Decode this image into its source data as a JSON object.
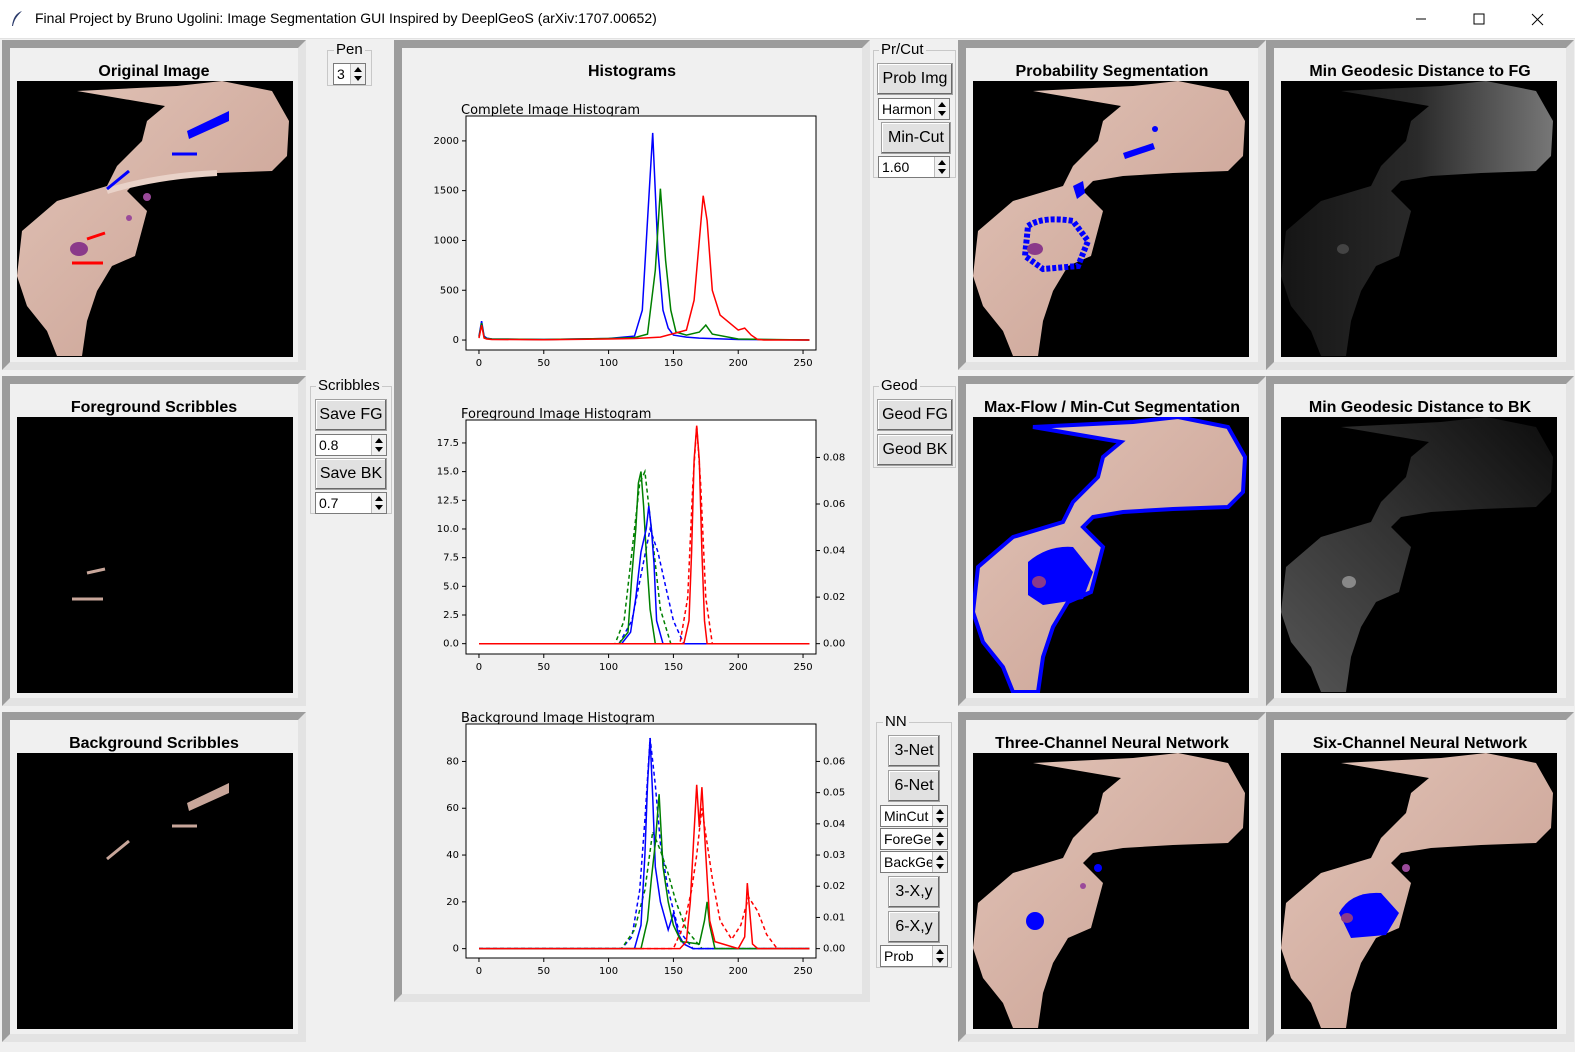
{
  "window": {
    "title": "Final Project by Bruno Ugolini: Image Segmentation GUI Inspired by DeeplGeoS (arXiv:1707.00652)"
  },
  "panels": {
    "original": "Original Image",
    "fg_scribbles": "Foreground Scribbles",
    "bk_scribbles": "Background Scribbles",
    "histograms": "Histograms",
    "prob_seg": "Probability Segmentation",
    "geo_fg": "Min Geodesic Distance to FG",
    "maxflow": "Max-Flow / Min-Cut Segmentation",
    "geo_bk": "Min Geodesic Distance to BK",
    "three_net": "Three-Channel Neural Network",
    "six_net": "Six-Channel Neural Network"
  },
  "controls": {
    "pen": {
      "label": "Pen",
      "value": "3"
    },
    "scribbles": {
      "label": "Scribbles",
      "save_fg": "Save FG",
      "fg_value": "0.8",
      "save_bk": "Save BK",
      "bk_value": "0.7"
    },
    "prcut": {
      "label": "Pr/Cut",
      "prob_img": "Prob Img",
      "method": "Harmon",
      "min_cut": "Min-Cut",
      "value": "1.60"
    },
    "geod": {
      "label": "Geod",
      "geod_fg": "Geod FG",
      "geod_bk": "Geod BK"
    },
    "nn": {
      "label": "NN",
      "net3": "3-Net",
      "net6": "6-Net",
      "opt1": "MinCut",
      "opt2": "ForeGeo",
      "opt3": "BackGeo",
      "xy3": "3-X,y",
      "xy6": "6-X,y",
      "mode": "Prob"
    }
  },
  "colors": {
    "red": "#ff0000",
    "green": "#008000",
    "blue": "#0000ff",
    "tissue": "#d6b5a8",
    "overlay": "#0000ff"
  },
  "chart_data": [
    {
      "type": "line",
      "title": "Complete Image Histogram",
      "xlim": [
        -10,
        260
      ],
      "ylim": [
        -100,
        2250
      ],
      "xticks": [
        "0",
        "50",
        "100",
        "150",
        "200",
        "250"
      ],
      "yticks": [
        "0",
        "500",
        "1000",
        "1500",
        "2000"
      ],
      "series": [
        {
          "color": "blue",
          "x": [
            0,
            2,
            4,
            6,
            10,
            50,
            100,
            120,
            126,
            130,
            134,
            138,
            142,
            146,
            150,
            160,
            170,
            200,
            255
          ],
          "values": [
            40,
            190,
            40,
            20,
            10,
            5,
            15,
            40,
            300,
            1200,
            2080,
            900,
            300,
            120,
            50,
            30,
            20,
            5,
            0
          ]
        },
        {
          "color": "green",
          "x": [
            0,
            2,
            4,
            6,
            10,
            50,
            100,
            120,
            130,
            136,
            140,
            144,
            148,
            152,
            160,
            170,
            175,
            180,
            200,
            255
          ],
          "values": [
            30,
            170,
            30,
            15,
            10,
            5,
            15,
            25,
            60,
            700,
            1520,
            800,
            300,
            80,
            50,
            80,
            150,
            60,
            10,
            0
          ]
        },
        {
          "color": "red",
          "x": [
            0,
            2,
            4,
            6,
            10,
            50,
            100,
            120,
            140,
            160,
            166,
            170,
            173,
            176,
            180,
            186,
            200,
            205,
            210,
            215,
            220,
            255
          ],
          "values": [
            20,
            150,
            20,
            10,
            5,
            3,
            10,
            15,
            30,
            100,
            400,
            1000,
            1450,
            1200,
            500,
            250,
            100,
            120,
            50,
            5,
            0,
            0
          ]
        }
      ]
    },
    {
      "type": "line",
      "title": "Foreground Image Histogram",
      "xlim": [
        -10,
        260
      ],
      "ylim": [
        -0.9,
        19.5
      ],
      "xticks": [
        "0",
        "50",
        "100",
        "150",
        "200",
        "250"
      ],
      "yticks": [
        "0.0",
        "2.5",
        "5.0",
        "7.5",
        "10.0",
        "12.5",
        "15.0",
        "17.5"
      ],
      "y2ticks": [
        "0.00",
        "0.02",
        "0.04",
        "0.06",
        "0.08"
      ],
      "series": [
        {
          "color": "green",
          "x": [
            0,
            108,
            115,
            118,
            121,
            123,
            125,
            127,
            129,
            132,
            136,
            255
          ],
          "values": [
            0,
            0,
            1,
            6,
            10,
            14,
            15,
            12,
            8,
            3,
            0,
            0
          ]
        },
        {
          "color": "blue",
          "x": [
            0,
            110,
            117,
            121,
            125,
            129,
            131,
            133,
            135,
            137,
            142,
            255
          ],
          "values": [
            0,
            0,
            1,
            4,
            8,
            10,
            12,
            10,
            7,
            2,
            0,
            0
          ]
        },
        {
          "color": "red",
          "x": [
            0,
            158,
            162,
            164,
            166,
            168,
            170,
            172,
            174,
            176,
            255
          ],
          "values": [
            0,
            0,
            2,
            8,
            16,
            19,
            16,
            8,
            2,
            0,
            0
          ]
        }
      ],
      "dashed": [
        {
          "color": "green",
          "x": [
            0,
            105,
            112,
            118,
            124,
            128,
            134,
            140,
            148,
            255
          ],
          "values": [
            0,
            0,
            2,
            8,
            14,
            15,
            9,
            3,
            0,
            0
          ]
        },
        {
          "color": "blue",
          "x": [
            0,
            108,
            118,
            125,
            132,
            138,
            144,
            150,
            158,
            255
          ],
          "values": [
            0,
            0,
            2,
            6,
            10,
            8,
            5,
            2,
            0,
            0
          ]
        },
        {
          "color": "red",
          "x": [
            0,
            155,
            161,
            165,
            168,
            171,
            175,
            180,
            255
          ],
          "values": [
            0,
            0,
            4,
            14,
            19,
            14,
            4,
            0,
            0
          ]
        }
      ]
    },
    {
      "type": "line",
      "title": "Background Image Histogram",
      "xlim": [
        -10,
        260
      ],
      "ylim": [
        -4,
        96
      ],
      "xticks": [
        "0",
        "50",
        "100",
        "150",
        "200",
        "250"
      ],
      "yticks": [
        "0",
        "20",
        "40",
        "60",
        "80"
      ],
      "y2ticks": [
        "0.00",
        "0.01",
        "0.02",
        "0.03",
        "0.04",
        "0.05",
        "0.06"
      ],
      "series": [
        {
          "color": "blue",
          "x": [
            0,
            120,
            125,
            128,
            130,
            132,
            134,
            136,
            140,
            146,
            150,
            154,
            158,
            165,
            255
          ],
          "values": [
            0,
            0,
            10,
            40,
            70,
            90,
            65,
            35,
            20,
            8,
            15,
            6,
            2,
            0,
            0
          ]
        },
        {
          "color": "green",
          "x": [
            0,
            125,
            130,
            133,
            136,
            139,
            142,
            146,
            150,
            156,
            170,
            174,
            176,
            178,
            182,
            255
          ],
          "values": [
            0,
            0,
            12,
            30,
            45,
            66,
            35,
            20,
            10,
            3,
            2,
            12,
            20,
            10,
            0,
            0
          ]
        },
        {
          "color": "red",
          "x": [
            0,
            155,
            160,
            163,
            166,
            168,
            170,
            172,
            175,
            178,
            182,
            200,
            205,
            207,
            209,
            211,
            215,
            255
          ],
          "values": [
            0,
            0,
            3,
            20,
            50,
            70,
            52,
            69,
            40,
            12,
            3,
            0,
            5,
            28,
            15,
            2,
            0,
            0
          ]
        }
      ],
      "dashed": [
        {
          "color": "blue",
          "x": [
            0,
            110,
            118,
            124,
            128,
            132,
            136,
            140,
            146,
            154,
            165,
            255
          ],
          "values": [
            0,
            0,
            5,
            25,
            55,
            90,
            70,
            45,
            25,
            8,
            0,
            0
          ]
        },
        {
          "color": "green",
          "x": [
            0,
            110,
            120,
            128,
            134,
            140,
            146,
            152,
            160,
            172,
            255
          ],
          "values": [
            0,
            0,
            8,
            25,
            50,
            42,
            32,
            20,
            8,
            0,
            0
          ]
        },
        {
          "color": "red",
          "x": [
            0,
            150,
            158,
            164,
            168,
            172,
            176,
            180,
            186,
            195,
            202,
            208,
            215,
            222,
            230,
            255
          ],
          "values": [
            0,
            0,
            10,
            25,
            40,
            60,
            45,
            30,
            12,
            4,
            10,
            22,
            16,
            6,
            0,
            0
          ]
        }
      ]
    }
  ]
}
